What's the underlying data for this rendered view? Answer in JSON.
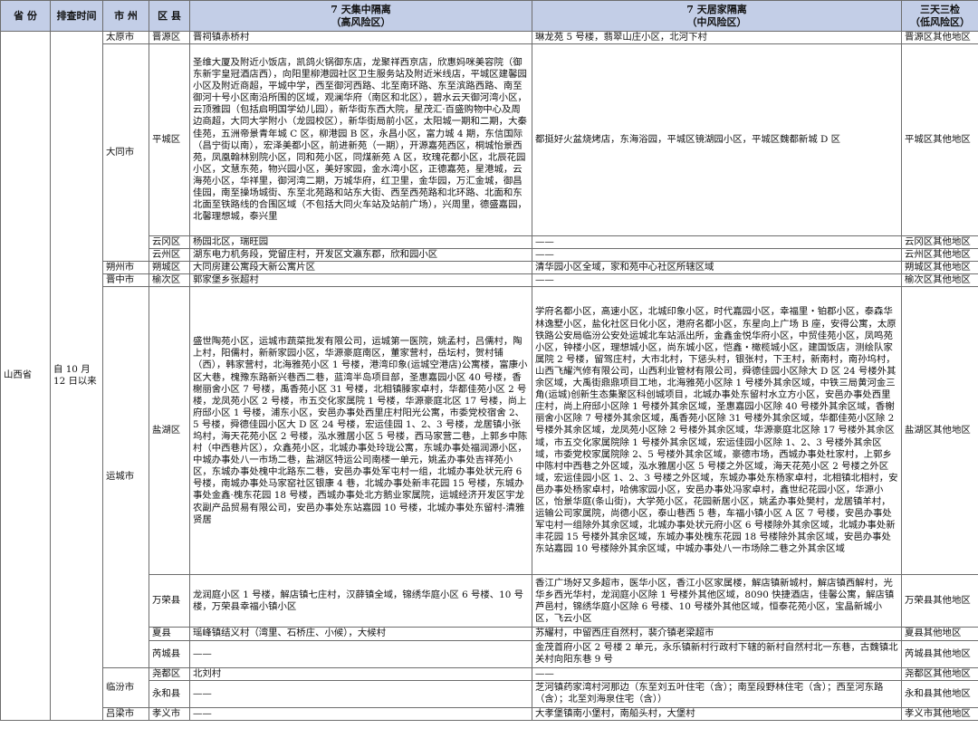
{
  "headers": {
    "province": "省  份",
    "time": "排查时间",
    "city": "市  州",
    "county": "区  县",
    "high_line1": "7 天集中隔离",
    "high_line2": "（高风险区）",
    "mid_line1": "7 天居家隔离",
    "mid_line2": "（中风险区）",
    "low_line1": "三天三检",
    "low_line2": "（低风险区）"
  },
  "province": "山西省",
  "time": "自 10 月 12 日以来",
  "cities": {
    "taiyuan": "太原市",
    "datong": "大同市",
    "shuozhou": "朔州市",
    "jinzhong": "晋中市",
    "yuncheng": "运城市",
    "linfen": "临汾市",
    "lvliang": "吕梁市"
  },
  "rows": {
    "jinyuan": {
      "county": "晋源区",
      "high": "晋祠镇赤桥村",
      "mid": "琳龙苑 5 号楼，翡翠山庄小区，北河下村",
      "low": "晋源区其他地区"
    },
    "pingcheng": {
      "county": "平城区",
      "high": "圣维大厦及附近小饭店，凯鸽火锅御东店，龙聚祥西京店，欣惠妈咪美容院（御东新宇皇冠酒店西），向阳里柳港园社区卫生服务站及附近米线店，平城区建馨园小区及附近商超，平城中学，西至御河西路、北至南环路、东至滨路西路、南至御河十号小区南沿所围的区域，观澜华府（南区和北区），碧水云天御河湾小区，云顶雅园（包括启明国学幼儿园），新华街东西大院，星茂汇·百盛购物中心及周边商超，大同大学附小（龙园校区），新华街局前小区，太阳城一期和二期，大秦佳苑，五洲帝景青年城 C 区，柳港园 B 区，永昌小区，富力城 4 期，东信国际（昌宁街以南），宏泽美都小区，前进新苑（一期），开源嘉苑西区，桐城怡景西苑，凤凰翰林别院小区，同和苑小区，同煤新苑 A 区，玫瑰花都小区，北辰花园小区，文慧东苑，物兴园小区，美好家园，金水湾小区，正德嘉苑，星港城，云海苑小区，华祥里，御河湾二期，万城华府，红卫里，金华园，万汇金城，御昌佳园，南至操场城街、东至北苑路和站东大街、西至西苑路和北环路、北面和东北面至铁路线的合围区域（不包括大同火车站及站前广场），兴周里，德盛嘉园，北馨理想城，泰兴里",
      "mid": "都挺好火盆烧烤店，东海浴园，平城区镜湖园小区，平城区魏都新城 D 区",
      "low": "平城区其他地区"
    },
    "yungang": {
      "county": "云冈区",
      "high": "杨园北区，瑞旺园",
      "mid": "——",
      "low": "云冈区其他地区"
    },
    "yunzhou": {
      "county": "云州区",
      "high": "湖东电力机务段，党留庄村，开发区文瀛东郡，欣和园小区",
      "mid": "——",
      "low": "云州区其他地区"
    },
    "shuocheng": {
      "county": "朔城区",
      "high": "大同房建公寓段大新公寓片区",
      "mid": "清华园小区全域，家和苑中心社区所辖区域",
      "low": "朔城区其他地区"
    },
    "yuci": {
      "county": "榆次区",
      "high": "郭家堡乡张超村",
      "mid": "——",
      "low": "榆次区其他地区"
    },
    "yanhu": {
      "county": "盐湖区",
      "high": "盛世陶苑小区，运城市蔬菜批发有限公司，运城第一医院，姚孟村，吕儒村，陶上村，阳儒村，新新家园小区，华源豪庭南区，董家营村，岳坛村，贺村铺（西），韩家营村，北海雅苑小区 1 号楼，港湾印象(运城空港店)公寓楼，富康小区大巷，槐豫东路新兴巷西二巷，蓝湾半岛项目部，圣惠嘉园小区 40 号楼，香榭丽舍小区 7 号楼，禹香苑小区 31 号楼，北相镇滕家卓村，华都佳苑小区 2 号楼，龙凤苑小区 2 号楼，市五交化家属院 1 号楼，华源豪庭北区 17 号楼，尚上府邸小区 1 号楼，浦东小区，安邑办事处西里庄村阳光公寓，市委党校宿舍 2、5 号楼，舜德佳园小区大 D 区 24 号楼，宏运佳园 1、2、3 号楼，龙居镇小张坞村，海天花苑小区 2 号楼，泓水雅居小区 5 号楼，西马家营二巷，上郭乡中陈村（中西巷片区），众鑫苑小区，北城办事处玲珑公寓，东城办事处福润源小区，中城办事处八一市场二巷，盐湖区特运公司南楼一单元，姚孟办事处吉祥苑小区，东城办事处槐中北路东二巷，安邑办事处军屯村一组，北城办事处状元府 6 号楼，南城办事处马家窑社区银康 4 巷，北城办事处新丰花园 15 号楼，东城办事处金鑫·槐东花园 18 号楼，西城办事处北方鹅业家属院，运城经济开发区宇龙农副产品贸易有限公司，安邑办事处东站嘉园 10 号楼，北城办事处东留村-清雅贤居",
      "mid": "学府名都小区，高速小区，北城印象小区，时代嘉园小区，幸福里・铂郡小区，泰森华林逸墅小区，盐化社区日化小区，港府名都小区，东星向上广场 B 座，安得公寓，太原铁路公安局临汾公安处运城北车站派出所，金鑫金悦华府小区，中贸佳苑小区，凤鸣苑小区，钟楼小区，理想城小区，尚东城小区，恺鑫・橄榄城小区，建国饭店，测绘队家属院 2 号楼，留驾庄村，大市北村，下惩头村，银张村，下王村，新南村，南孙坞村，山西飞耀汽修有限公司，山西利业管材有限公司，舜德佳园小区除大 D 区 24 号楼外其余区域，大禹街鼎鼎项目工地，北海雅苑小区除 1 号楼外其余区域，中铁三局黄河金三角(运城)创新生态集聚区科创城项目，北城办事处东留村水立方小区，安邑办事处西里庄村，尚上府邸小区除 1 号楼外其余区域，圣惠嘉园小区除 40 号楼外其余区域，香榭丽舍小区除 7 号楼外其余区域，禹香苑小区除 31 号楼外其余区域，华都佳苑小区除 2 号楼外其余区域，龙凤苑小区除 2 号楼外其余区域，华源豪庭北区除 17 号楼外其余区域，市五交化家属院除 1 号楼外其余区域，宏运佳园小区除 1、2、3 号楼外其余区域，市委党校家属院除 2、5 号楼外其余区域，豪德市场，西城办事处杜家村，上郭乡中陈村中西巷之外区域，泓水雅居小区 5 号楼之外区域，海天花苑小区 2 号楼之外区域，宏运佳园小区 1、2、3 号楼之外区域，东城办事处东杨家卓村，北相镇北相村，安邑办事处杨家卓村，哈佛家园小区，安邑办事处冯家卓村，鑫世纪花园小区，华源小区，怡景华庭(条山街)，大学苑小区，花园新居小区，姚孟办事处樊村，龙居镇羊村，运输公司家属院，尚德小区，泰山巷西 5 巷，车福小镇小区 A 区 7 号楼，安邑办事处军屯村一组除外其余区域，北城办事处状元府小区 6 号楼除外其余区域，北城办事处新丰花园 15 号楼外其余区域，东城办事处槐东花园 18 号楼除外其余区域，安邑办事处东站嘉园 10 号楼除外其余区域，中城办事处八一市场除二巷之外其余区域",
      "low": "盐湖区其他地区"
    },
    "wanrong": {
      "county": "万荣县",
      "high": "龙润庭小区 1 号楼，解店镇七庄村，汉薛镇全域，锦绣华庭小区 6 号楼、10 号楼，万荣县幸福小镇小区",
      "mid": "香江广场好又多超市，医华小区，香江小区家属楼，解店镇新城村，解店镇西解村，光华乡西光华村，龙润庭小区除 1 号楼外其他区域，8090 快捷酒店，佳馨公寓，解店镇芦邑村，锦绣华庭小区除 6 号楼、10 号楼外其他区域，恒泰花苑小区，宝晶新城小区，飞云小区",
      "low": "万荣县其他地区"
    },
    "xiaxian": {
      "county": "夏县",
      "high": "瑶峰镇结义村（湾里、石桥庄、小候），大候村",
      "mid": "苏耀村，中留西庄自然村，裴介镇老梁超市",
      "low": "夏县其他地区"
    },
    "ruicheng": {
      "county": "芮城县",
      "high": "——",
      "mid": "金茂首府小区 2 号楼 2 单元，永乐镇新村行政村下辖的新村自然村北一东巷，古魏镇北关村向阳东巷 9 号",
      "low": "芮城县其他地区"
    },
    "yaodu": {
      "county": "尧都区",
      "high": "北刘村",
      "mid": "——",
      "low": "尧都区其他地区"
    },
    "yonghe": {
      "county": "永和县",
      "high": "——",
      "mid": "芝河镇药家湾村河那边（东至刘五叶住宅（含）；南至段野林住宅（含）；西至河东路（含）；北至刘海泉住宅（含））",
      "low": "永和县其他地区"
    },
    "xiaoyi": {
      "county": "孝义市",
      "high": "——",
      "mid": "大孝堡镇南小堡村，南船头村，大堡村",
      "low": "孝义市其他地区"
    }
  }
}
